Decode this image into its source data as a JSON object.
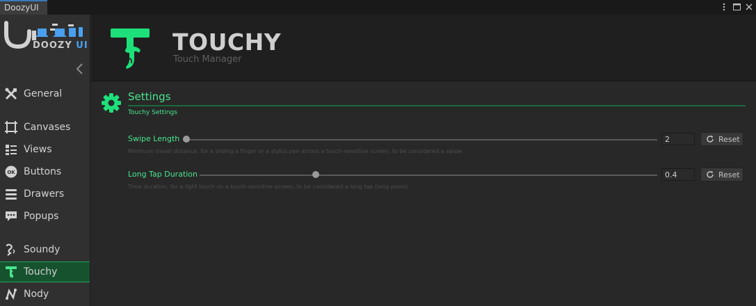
{
  "window": {
    "tab_label": "DoozyUI"
  },
  "logo": {
    "text_main": "DOOZY",
    "text_accent": "UI"
  },
  "sidebar": {
    "items": [
      {
        "label": "General",
        "icon": "wrench-screwdriver-icon"
      },
      {
        "label": "Canvases",
        "icon": "canvas-crop-icon"
      },
      {
        "label": "Views",
        "icon": "views-list-icon"
      },
      {
        "label": "Buttons",
        "icon": "ok-button-icon"
      },
      {
        "label": "Drawers",
        "icon": "drawers-icon"
      },
      {
        "label": "Popups",
        "icon": "popup-speech-icon"
      },
      {
        "label": "Soundy",
        "icon": "soundy-icon"
      },
      {
        "label": "Touchy",
        "icon": "touchy-hand-icon"
      },
      {
        "label": "Nody",
        "icon": "nody-graph-icon"
      }
    ],
    "active": "Touchy"
  },
  "header": {
    "title": "TOUCHY",
    "subtitle": "Touch Manager"
  },
  "section": {
    "title": "Settings",
    "subtitle": "Touchy Settings"
  },
  "settings": [
    {
      "label": "Swipe Length",
      "value": "2",
      "slider_fraction": 0.0,
      "description": "Minimum travel distance, for a sliding a finger or a stylus pen across a touch-sensitive screen, to be considered a swipe",
      "reset_label": "Reset"
    },
    {
      "label": "Long Tap Duration",
      "value": "0.4",
      "slider_fraction": 0.25,
      "description": "Time duration, for a light touch on a touch-sensitive screen, to be considered a long tap (long press)",
      "reset_label": "Reset"
    }
  ],
  "colors": {
    "accent_green": "#49e58e",
    "logo_blue": "#4aa0ef",
    "active_bg": "#17522f"
  }
}
